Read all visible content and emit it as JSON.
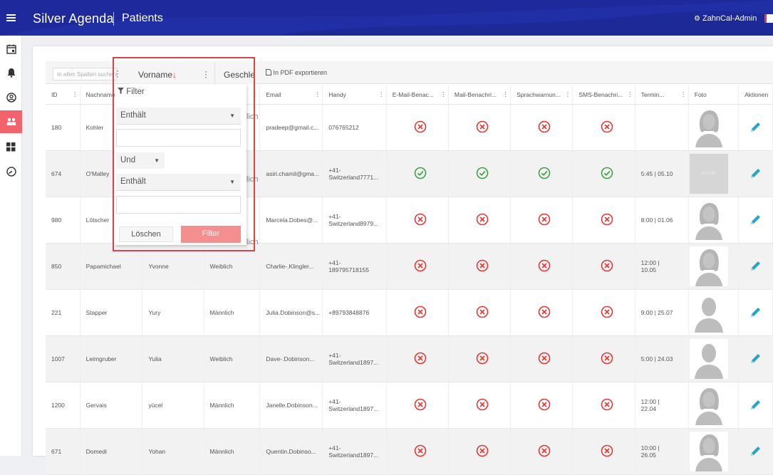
{
  "header": {
    "app_title": "Silver Agenda",
    "page_title": "Patients",
    "user": "ZahnCal-Admin"
  },
  "sidebar": {
    "items": [
      {
        "icon": "calendar-icon"
      },
      {
        "icon": "bell-icon"
      },
      {
        "icon": "user-circle-icon"
      },
      {
        "icon": "patients-icon",
        "active": true
      },
      {
        "icon": "dashboard-icon"
      },
      {
        "icon": "gauge-icon"
      }
    ]
  },
  "toolbar": {
    "search_placeholder": "In allen Spalten suchen",
    "pdf_export": "In PDF exportieren"
  },
  "filter_popup": {
    "column_header": "Vorname",
    "next_column_header": "Geschlecht",
    "title": "Filter",
    "condition1": "Enthält",
    "operator": "Und",
    "condition2": "Enthält",
    "clear_button": "Löschen",
    "apply_button": "Filter"
  },
  "table": {
    "columns": [
      "ID",
      "Nachname",
      "Vorname",
      "Geschlecht",
      "Email",
      "Handy",
      "E-Mail-Benac...",
      "Mail-Benachri...",
      "Sprachwarnun...",
      "SMS-Benachri...",
      "Termin...",
      "Foto",
      "Aktionen"
    ],
    "rows": [
      {
        "id": "180",
        "nachname": "Kohler",
        "vorname": "",
        "geschlecht": "",
        "email": "pradeep@gmail.c...",
        "handy": [
          "076765212"
        ],
        "flags": [
          false,
          false,
          false,
          false
        ],
        "termin": [],
        "photo": "female"
      },
      {
        "id": "674",
        "nachname": "O'Malley",
        "vorname": "",
        "geschlecht": "",
        "email": "asiri.chamil@gma...",
        "handy": [
          "+41-",
          "Switzerland7771..."
        ],
        "flags": [
          true,
          true,
          true,
          true
        ],
        "termin": [
          "5:45 | 05.10"
        ],
        "photo": "placeholder",
        "photo_text": "80 x 80"
      },
      {
        "id": "980",
        "nachname": "Lötscher",
        "vorname": "",
        "geschlecht": "",
        "email": "Marcela.Dobes@...",
        "handy": [
          "+41-",
          "Switzerland8979..."
        ],
        "flags": [
          false,
          false,
          false,
          false
        ],
        "termin": [
          "8:00 | 01.06"
        ],
        "photo": "female"
      },
      {
        "id": "850",
        "nachname": "Papamichael",
        "vorname": "Yvonne",
        "geschlecht": "Weiblich",
        "email": "Charlie-.Klingler...",
        "handy": [
          "+41-",
          "189795718155"
        ],
        "flags": [
          false,
          false,
          false,
          false
        ],
        "termin": [
          "12:00 |",
          "10.05"
        ],
        "photo": "female"
      },
      {
        "id": "221",
        "nachname": "Stapper",
        "vorname": "Yury",
        "geschlecht": "Männlich",
        "email": "Julia.Dobinson@s...",
        "handy": [
          "+89793848876"
        ],
        "flags": [
          false,
          false,
          false,
          false
        ],
        "termin": [
          "9:00 | 25.07"
        ],
        "photo": "male"
      },
      {
        "id": "1007",
        "nachname": "Leimgruber",
        "vorname": "Yulia",
        "geschlecht": "Weiblich",
        "email": "Dave-.Dobinson...",
        "handy": [
          "+41-",
          "Switzerland1897..."
        ],
        "flags": [
          false,
          false,
          false,
          false
        ],
        "termin": [
          "5:00 | 24.03"
        ],
        "photo": "male"
      },
      {
        "id": "1200",
        "nachname": "Gervais",
        "vorname": "yücel",
        "geschlecht": "Männlich",
        "email": "Janelle.Dobinson...",
        "handy": [
          "+41-",
          "Switzerland1897..."
        ],
        "flags": [
          false,
          false,
          false,
          false
        ],
        "termin": [
          "12:00 |",
          "22.04"
        ],
        "photo": "female"
      },
      {
        "id": "671",
        "nachname": "Domedi",
        "vorname": "Yohan",
        "geschlecht": "Männlich",
        "email": "Quentin.Dobinso...",
        "handy": [
          "+41-",
          "Switzerland1897..."
        ],
        "flags": [
          false,
          false,
          false,
          false
        ],
        "termin": [
          "10:00 |",
          "26.05"
        ],
        "photo": "female"
      }
    ]
  },
  "ghost_text": [
    "lich",
    "lich",
    "lich"
  ],
  "colors": {
    "header_bg": "#1e2a9c",
    "accent": "#f1646b",
    "check": "#43a047",
    "cross": "#e53935",
    "edit": "#26a6c4"
  }
}
